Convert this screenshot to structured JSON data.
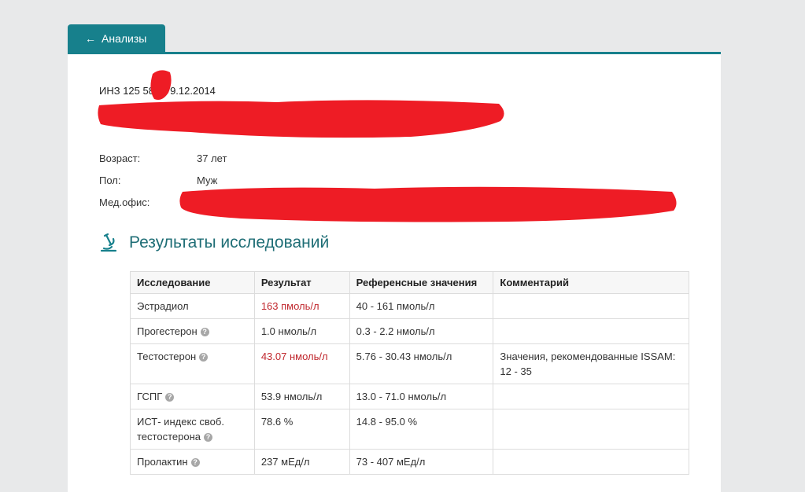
{
  "nav": {
    "back_label": "Анализы",
    "back_icon": "arrow-left-icon"
  },
  "document": {
    "title": "ИНЗ 125  58 от 9.12.2014"
  },
  "patient": {
    "age_label": "Возраст:",
    "age_value": "37 лет",
    "sex_label": "Пол:",
    "sex_value": "Муж",
    "office_label": "Мед.офис:"
  },
  "section": {
    "title": "Результаты исследований",
    "icon": "microscope-icon"
  },
  "table": {
    "headers": [
      "Исследование",
      "Результат",
      "Референсные значения",
      "Комментарий"
    ],
    "rows": [
      {
        "test": "Эстрадиол",
        "help": false,
        "result": "163 пмоль/л",
        "abnormal": true,
        "reference": "40 - 161 пмоль/л",
        "comment": ""
      },
      {
        "test": "Прогестерон",
        "help": true,
        "result": "1.0 нмоль/л",
        "abnormal": false,
        "reference": "0.3 - 2.2 нмоль/л",
        "comment": ""
      },
      {
        "test": "Тестостерон",
        "help": true,
        "result": "43.07 нмоль/л",
        "abnormal": true,
        "reference": "5.76 - 30.43 нмоль/л",
        "comment": "Значения, рекомендованные ISSAM: 12 - 35"
      },
      {
        "test": "ГСПГ",
        "help": true,
        "result": "53.9 нмоль/л",
        "abnormal": false,
        "reference": "13.0 - 71.0 нмоль/л",
        "comment": ""
      },
      {
        "test": "ИСТ- индекс своб. тестостерона",
        "help": true,
        "result": "78.6 %",
        "abnormal": false,
        "reference": "14.8 - 95.0 %",
        "comment": ""
      },
      {
        "test": "Пролактин",
        "help": true,
        "result": "237 мЕд/л",
        "abnormal": false,
        "reference": "73 - 407 мЕд/л",
        "comment": ""
      }
    ]
  },
  "colors": {
    "accent": "#17808c",
    "title": "#1f6e76",
    "abnormal": "#c0272d",
    "redaction": "#ee1c25"
  }
}
